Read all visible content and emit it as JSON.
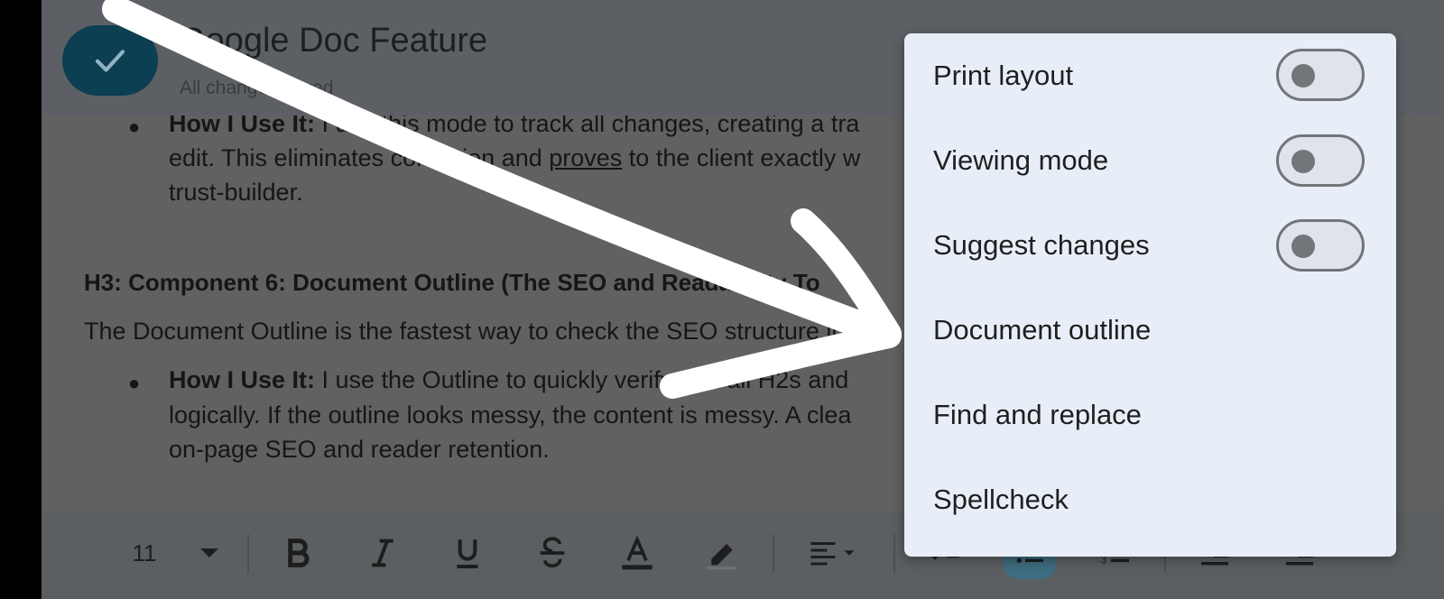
{
  "header": {
    "title": "Google Doc Feature",
    "status": "All changes saved"
  },
  "document": {
    "bullet1": {
      "lead": "How I Use It:",
      "line1": " I use this mode to track all changes, creating a tra",
      "line2_a": "edit. This eliminates confusion and ",
      "line2_u": "proves",
      "line2_b": " to the client exactly w",
      "line3": "trust-builder."
    },
    "heading": "H3: Component 6: Document Outline (The SEO and Readability To",
    "paragraph": "The Document Outline is the fastest way to check the SEO structure in",
    "bullet2": {
      "lead": "How I Use It:",
      "line1": " I use the Outline to quickly verify that all H2s and",
      "line2": "logically. If the outline looks messy, the content is messy. A clea",
      "line3": "on-page SEO and reader retention."
    }
  },
  "toolbar": {
    "font_size": "11"
  },
  "menu": {
    "items": [
      {
        "label": "Print layout",
        "toggle": false
      },
      {
        "label": "Viewing mode",
        "toggle": false
      },
      {
        "label": "Suggest changes",
        "toggle": false
      },
      {
        "label": "Document outline"
      },
      {
        "label": "Find and replace"
      },
      {
        "label": "Spellcheck"
      }
    ]
  }
}
